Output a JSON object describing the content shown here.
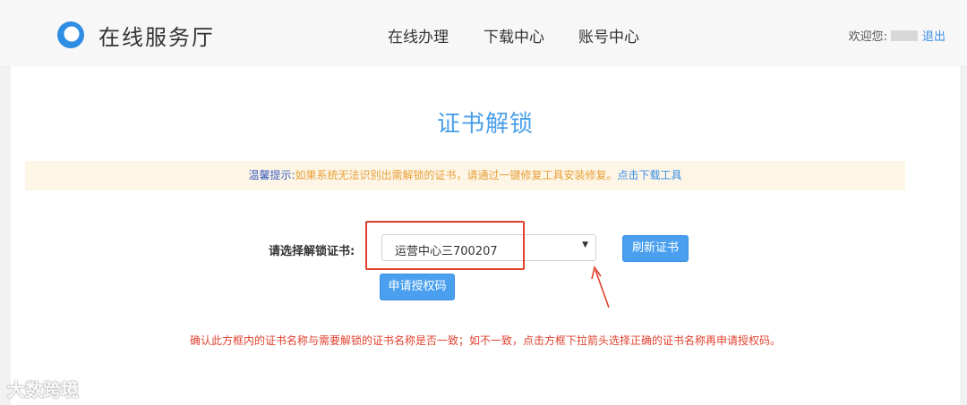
{
  "header": {
    "brand": "在线服务厅",
    "nav": [
      {
        "label": "在线办理"
      },
      {
        "label": "下载中心"
      },
      {
        "label": "账号中心"
      }
    ],
    "welcome_label": "欢迎您:",
    "logout_label": "退出"
  },
  "main": {
    "title": "证书解锁",
    "tip": {
      "label": "温馨提示:",
      "text": "如果系统无法识别出需解锁的证书，请通过一键修复工具安装修复。",
      "link": "点击下载工具"
    },
    "form": {
      "label": "请选择解锁证书:",
      "selected_value": "运营中心三700207",
      "caret": "▼",
      "refresh_button": "刷新证书",
      "apply_button": "申请授权码"
    },
    "warning": "确认此方框内的证书名称与需要解锁的证书名称是否一致；如不一致，点击方框下拉箭头选择正确的证书名称再申请授权码。"
  },
  "watermark": "大数跨境",
  "colors": {
    "accent": "#4a9fe8",
    "warning": "#e0412e",
    "tip_bg": "#fdf5e6",
    "tip_text": "#e8a23a"
  }
}
